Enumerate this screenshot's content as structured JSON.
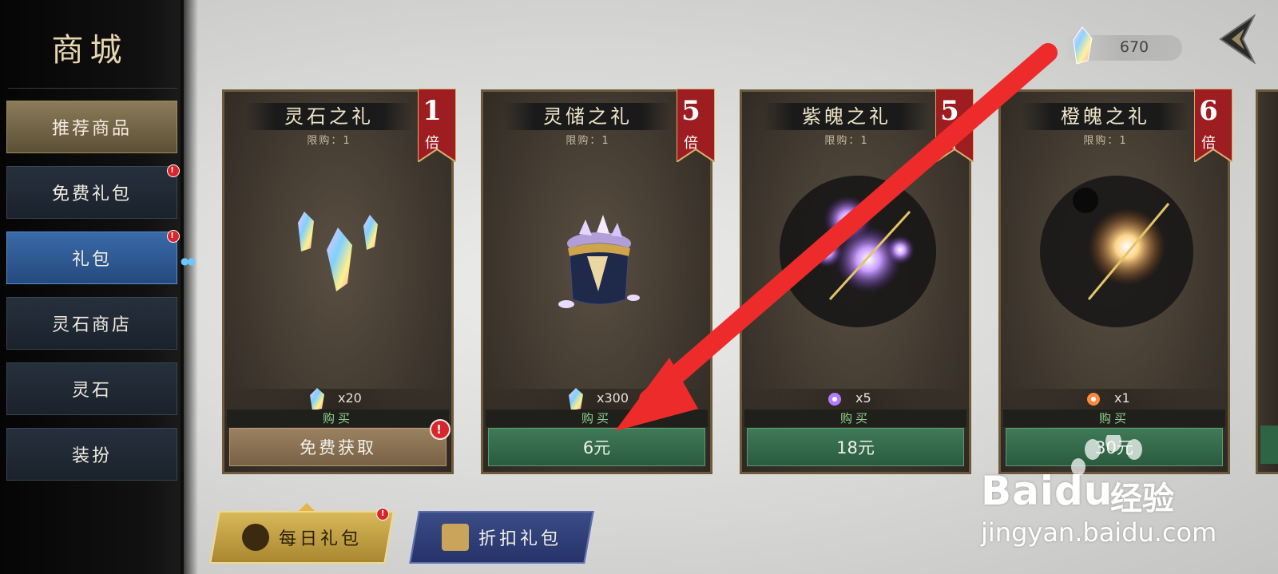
{
  "shop": {
    "title": "商城"
  },
  "sidebar": {
    "items": [
      {
        "label": "推荐商品",
        "style": "gold",
        "badge": false
      },
      {
        "label": "免费礼包",
        "style": "normal",
        "badge": true
      },
      {
        "label": "礼包",
        "style": "active",
        "badge": true
      },
      {
        "label": "灵石商店",
        "style": "normal",
        "badge": false
      },
      {
        "label": "灵石",
        "style": "normal",
        "badge": false
      },
      {
        "label": "装扮",
        "style": "normal",
        "badge": false
      }
    ]
  },
  "currency": {
    "value": "670",
    "icon": "spirit-crystal-icon"
  },
  "cards": [
    {
      "title": "灵石之礼",
      "limit": "限购：1",
      "multiplier": "1",
      "multiplier_unit": "倍",
      "item_icon": "spirit-crystal-icon",
      "quantity": "x20",
      "buy_label": "购买",
      "price": "免费获取",
      "free": true,
      "art": "crystals"
    },
    {
      "title": "灵储之礼",
      "limit": "限购：1",
      "multiplier": "5",
      "multiplier_unit": "倍",
      "item_icon": "spirit-crystal-icon",
      "quantity": "x300",
      "buy_label": "购买",
      "price": "6元",
      "free": false,
      "art": "pouch"
    },
    {
      "title": "紫魄之礼",
      "limit": "限购：1",
      "multiplier": "5",
      "multiplier_unit": "倍",
      "item_icon": "purple-soul-icon",
      "quantity": "x5",
      "buy_label": "购买",
      "price": "18元",
      "free": false,
      "art": "purple-orb"
    },
    {
      "title": "橙魄之礼",
      "limit": "限购：1",
      "multiplier": "6",
      "multiplier_unit": "倍",
      "item_icon": "orange-soul-icon",
      "quantity": "x1",
      "buy_label": "购买",
      "price": "30元",
      "free": false,
      "art": "orange-orb"
    }
  ],
  "tabs": [
    {
      "label": "每日礼包",
      "icon": "star-gift-icon",
      "badge": true
    },
    {
      "label": "折扣礼包",
      "icon": "treasure-chest-icon",
      "badge": false
    }
  ],
  "watermark": {
    "brand": "Baidu",
    "cn": "经验",
    "url": "jingyan.baidu.com"
  },
  "colors": {
    "accent_green": "#2a5b3f",
    "badge_red": "#d8262a",
    "ribbon_red": "#9e1d20",
    "arrow_red": "#ee2b2b"
  }
}
